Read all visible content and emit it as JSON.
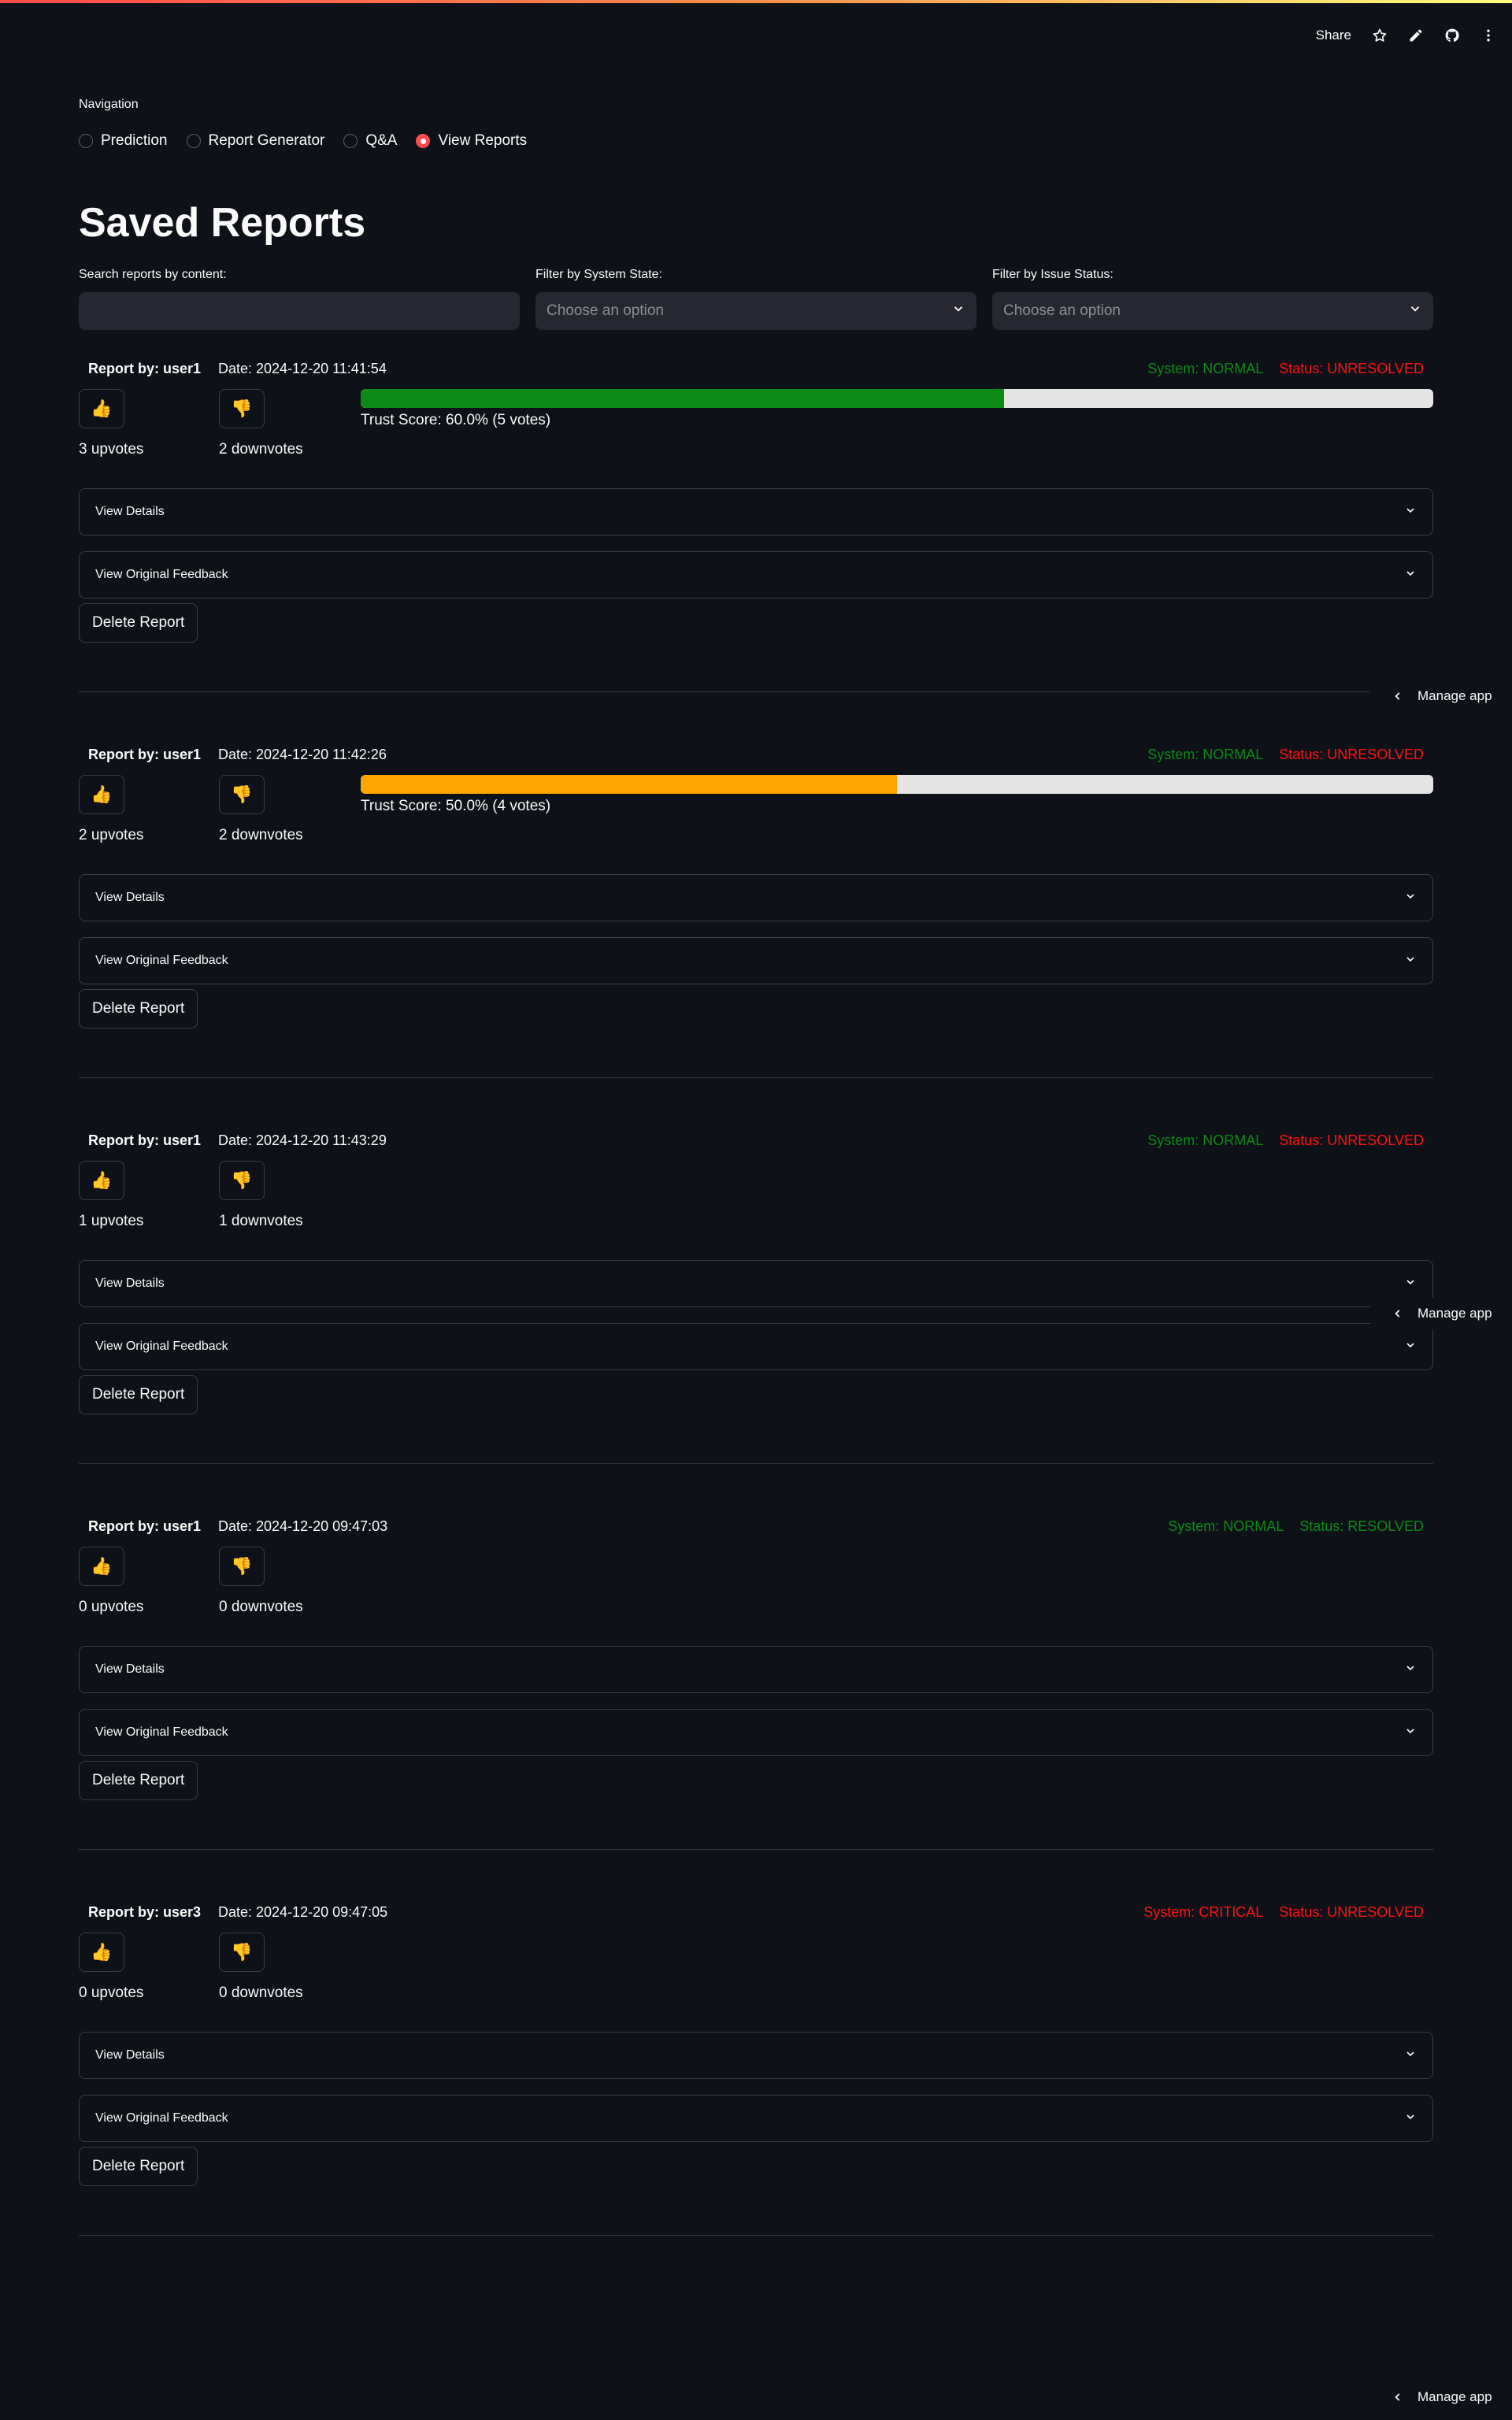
{
  "toolbar": {
    "share_label": "Share"
  },
  "nav": {
    "label": "Navigation",
    "options": [
      "Prediction",
      "Report Generator",
      "Q&A",
      "View Reports"
    ],
    "selected": "View Reports"
  },
  "page": {
    "title": "Saved Reports"
  },
  "filters": {
    "search_label": "Search reports by content:",
    "search_value": "",
    "system_label": "Filter by System State:",
    "system_placeholder": "Choose an option",
    "issue_label": "Filter by Issue Status:",
    "issue_placeholder": "Choose an option"
  },
  "colors": {
    "accent": "#ff4b4b",
    "normal_green": "#0b8a17",
    "alert_red": "#ff1212",
    "trust_high": "#0b8a17",
    "trust_mid": "#ffa500",
    "background": "#0e1117"
  },
  "icons": {
    "upvote": "👍",
    "downvote": "👎"
  },
  "expanders": {
    "details": "View Details",
    "feedback": "View Original Feedback"
  },
  "delete_label": "Delete Report",
  "manage_app_label": "Manage app",
  "reports": [
    {
      "by": "Report by: user1",
      "date": "Date: 2024-12-20 11:41:54",
      "system": "System: NORMAL",
      "status": "Status: UNRESOLVED",
      "system_ok": true,
      "status_ok": false,
      "upvotes": "3 upvotes",
      "downvotes": "2 downvotes",
      "trust_pct": 60.0,
      "trust_text": "Trust Score: 60.0% (5 votes)"
    },
    {
      "by": "Report by: user1",
      "date": "Date: 2024-12-20 11:42:26",
      "system": "System: NORMAL",
      "status": "Status: UNRESOLVED",
      "system_ok": true,
      "status_ok": false,
      "upvotes": "2 upvotes",
      "downvotes": "2 downvotes",
      "trust_pct": 50.0,
      "trust_text": "Trust Score: 50.0% (4 votes)"
    },
    {
      "by": "Report by: user1",
      "date": "Date: 2024-12-20 11:43:29",
      "system": "System: NORMAL",
      "status": "Status: UNRESOLVED",
      "system_ok": true,
      "status_ok": false,
      "upvotes": "1 upvotes",
      "downvotes": "1 downvotes"
    },
    {
      "by": "Report by: user1",
      "date": "Date: 2024-12-20 09:47:03",
      "system": "System: NORMAL",
      "status": "Status: RESOLVED",
      "system_ok": true,
      "status_ok": true,
      "upvotes": "0 upvotes",
      "downvotes": "0 downvotes"
    },
    {
      "by": "Report by: user3",
      "date": "Date: 2024-12-20 09:47:05",
      "system": "System: CRITICAL",
      "status": "Status: UNRESOLVED",
      "system_ok": false,
      "status_ok": false,
      "upvotes": "0 upvotes",
      "downvotes": "0 downvotes"
    }
  ]
}
